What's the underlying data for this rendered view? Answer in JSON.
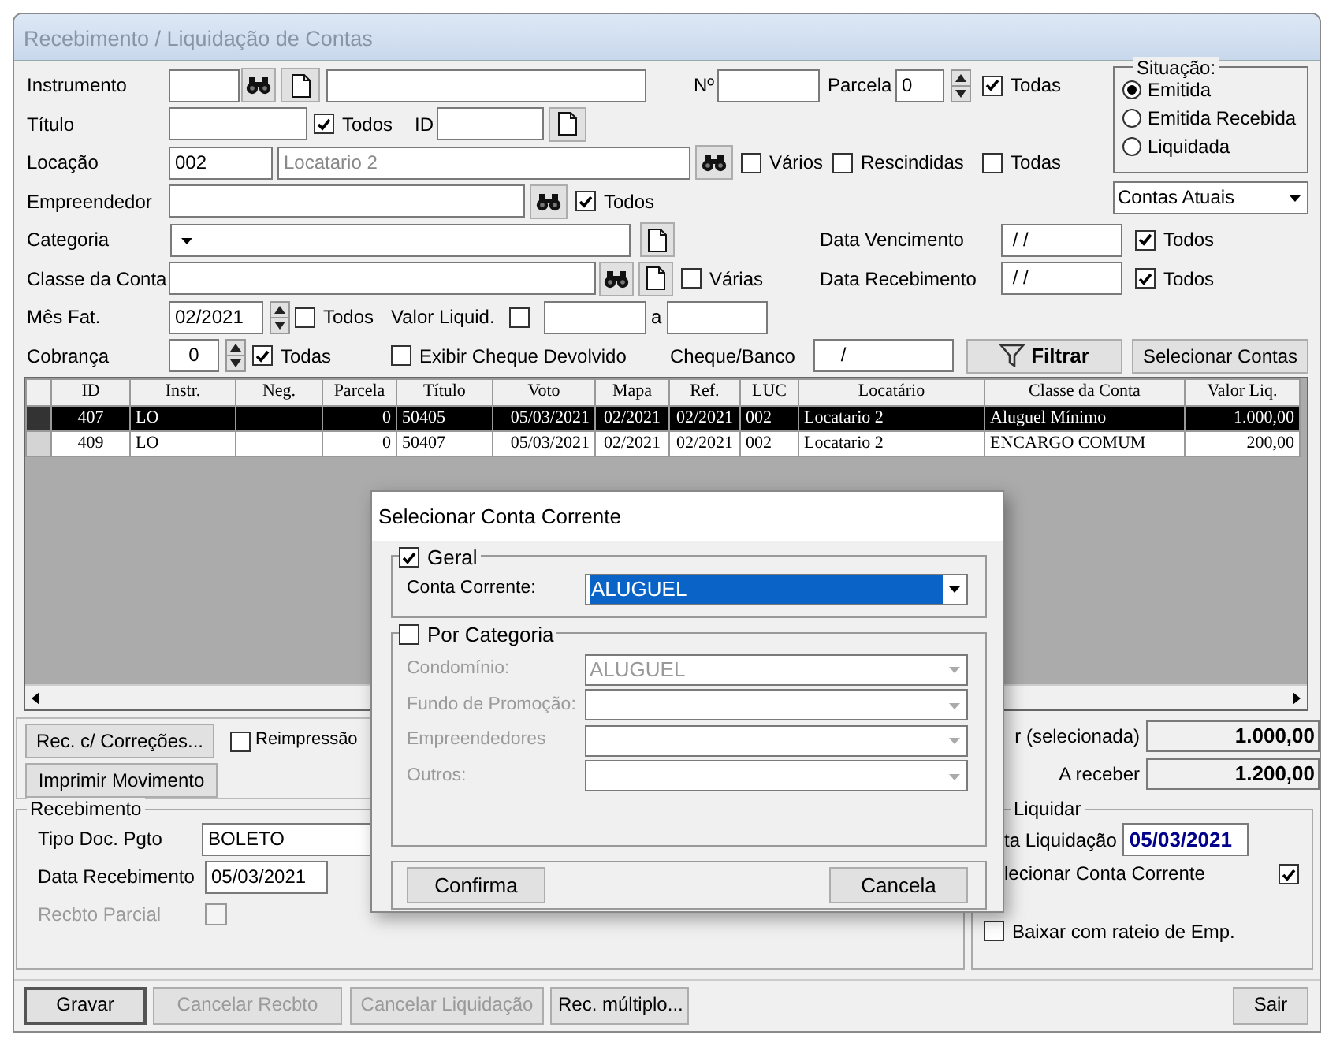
{
  "window": {
    "title": "Recebimento / Liquidação de Contas"
  },
  "filters": {
    "rows": [
      {
        "items": [
          {
            "kind": "label",
            "text": "Instrumento"
          },
          {
            "kind": "input"
          },
          {
            "kind": "find"
          },
          {
            "kind": "new"
          },
          {
            "kind": "input"
          },
          {
            "kind": "label",
            "text": "Nº"
          },
          {
            "kind": "input"
          },
          {
            "kind": "label",
            "text": "Parcela"
          },
          {
            "kind": "spin",
            "value": "0"
          },
          {
            "kind": "checkbox",
            "text": "Todas",
            "checked": true
          }
        ]
      },
      {
        "items": [
          {
            "kind": "label",
            "text": "Título"
          },
          {
            "kind": "input"
          },
          {
            "kind": "checkbox",
            "text": "Todos",
            "checked": true
          },
          {
            "kind": "label",
            "text": "ID"
          },
          {
            "kind": "input"
          },
          {
            "kind": "new"
          }
        ]
      },
      {
        "items": [
          {
            "kind": "label",
            "text": "Locação"
          },
          {
            "kind": "input",
            "value": "002"
          },
          {
            "kind": "input",
            "value": "Locatario 2",
            "readonly": true
          },
          {
            "kind": "find"
          },
          {
            "kind": "checkbox",
            "text": "Vários",
            "checked": false
          },
          {
            "kind": "checkbox",
            "text": "Rescindidas",
            "checked": false
          },
          {
            "kind": "checkbox",
            "text": "Todas",
            "checked": false
          }
        ]
      },
      {
        "items": [
          {
            "kind": "label",
            "text": "Empreendedor"
          },
          {
            "kind": "input"
          },
          {
            "kind": "find"
          },
          {
            "kind": "checkbox",
            "text": "Todos",
            "checked": true
          }
        ]
      },
      {
        "items": [
          {
            "kind": "label",
            "text": "Categoria"
          },
          {
            "kind": "select"
          },
          {
            "kind": "new"
          },
          {
            "kind": "label",
            "text": "Data Vencimento"
          },
          {
            "kind": "input",
            "value": " / /"
          },
          {
            "kind": "checkbox",
            "text": "Todos",
            "checked": true
          }
        ]
      },
      {
        "items": [
          {
            "kind": "label",
            "text": "Classe da Conta"
          },
          {
            "kind": "input"
          },
          {
            "kind": "find"
          },
          {
            "kind": "new"
          },
          {
            "kind": "checkbox",
            "text": "Várias",
            "checked": false
          },
          {
            "kind": "label",
            "text": "Data Recebimento"
          },
          {
            "kind": "input",
            "value": " / /"
          },
          {
            "kind": "checkbox",
            "text": "Todos",
            "checked": true
          }
        ]
      },
      {
        "items": [
          {
            "kind": "label",
            "text": "Mês Fat."
          },
          {
            "kind": "spin",
            "value": "02/2021"
          },
          {
            "kind": "checkbox",
            "text": "Todos",
            "checked": false
          },
          {
            "kind": "label",
            "text": "Valor Liquid."
          },
          {
            "kind": "checkbox",
            "checked": false
          },
          {
            "kind": "input"
          },
          {
            "kind": "label",
            "text": "a"
          },
          {
            "kind": "input"
          }
        ]
      },
      {
        "items": [
          {
            "kind": "label",
            "text": "Cobrança"
          },
          {
            "kind": "spin",
            "value": "0"
          },
          {
            "kind": "checkbox",
            "text": "Todas",
            "checked": true
          },
          {
            "kind": "checkbox",
            "text": "Exibir Cheque Devolvido",
            "checked": false
          },
          {
            "kind": "label",
            "text": "Cheque/Banco"
          },
          {
            "kind": "input",
            "value": "    /"
          },
          {
            "kind": "filter_button",
            "text": "Filtrar"
          },
          {
            "kind": "button",
            "text": "Selecionar Contas"
          }
        ]
      }
    ]
  },
  "situacao": {
    "legend": "Situação:",
    "options": [
      {
        "label": "Emitida",
        "selected": true
      },
      {
        "label": "Emitida Recebida",
        "selected": false
      },
      {
        "label": "Liquidada",
        "selected": false
      }
    ]
  },
  "contas_dropdown": {
    "value": "Contas Atuais"
  },
  "grid": {
    "columns": [
      "ID",
      "Instr.",
      "Neg.",
      "Parcela",
      "Título",
      "Voto",
      "Mapa",
      "Ref.",
      "LUC",
      "Locatário",
      "Classe da Conta",
      "Valor Liq."
    ],
    "rows": [
      {
        "selected": true,
        "cells": [
          "407",
          "LO",
          "",
          "0",
          "50405",
          "05/03/2021",
          "02/2021",
          "02/2021",
          "002",
          "Locatario 2",
          "Aluguel Mínimo",
          "1.000,00"
        ]
      },
      {
        "selected": false,
        "cells": [
          "409",
          "LO",
          "",
          "0",
          "50407",
          "05/03/2021",
          "02/2021",
          "02/2021",
          "002",
          "Locatario 2",
          "ENCARGO COMUM",
          "200,00"
        ]
      }
    ]
  },
  "actions": {
    "buttons": [
      "Rec. c/ Correções...",
      "Imprimir Movimento"
    ],
    "reimpressao": {
      "label": "Reimpressão",
      "checked": false
    }
  },
  "totals": [
    {
      "label": "r (selecionada)",
      "value": "1.000,00"
    },
    {
      "label": "A receber",
      "value": "1.200,00"
    }
  ],
  "recebimento": {
    "legend": "Recebimento",
    "tipo_label": "Tipo Doc. Pgto",
    "tipo_value": "BOLETO",
    "data_label": "Data Recebimento",
    "data_value": "05/03/2021",
    "parcial": {
      "label": "Recbto Parcial",
      "checked": false,
      "disabled": true
    }
  },
  "liquidar": {
    "legend": "Liquidar",
    "data_label": "ta Liquidação",
    "data_value": "05/03/2021",
    "conta_label": "lecionar Conta Corrente",
    "conta_checked": true,
    "rateio_label": "Baixar com rateio de Emp.",
    "rateio_checked": false
  },
  "footer_buttons": [
    {
      "label": "Gravar",
      "disabled": false
    },
    {
      "label": "Cancelar Recbto",
      "disabled": true
    },
    {
      "label": "Cancelar Liquidação",
      "disabled": true
    },
    {
      "label": "Rec. múltiplo...",
      "disabled": false
    },
    {
      "label": "Sair",
      "disabled": false
    }
  ],
  "dialog": {
    "title": "Selecionar Conta Corrente",
    "groups": [
      {
        "label": "Geral",
        "checked": true,
        "fields": [
          {
            "label": "Conta Corrente:",
            "value": "ALUGUEL",
            "selected": true
          }
        ]
      },
      {
        "label": "Por Categoria",
        "checked": false,
        "fields": [
          {
            "label": "Condomínio:",
            "value": "ALUGUEL"
          },
          {
            "label": "Fundo de Promoção:"
          },
          {
            "label": "Empreendedores"
          },
          {
            "label": "Outros:"
          }
        ]
      }
    ],
    "buttons": [
      "Confirma",
      "Cancela"
    ]
  }
}
